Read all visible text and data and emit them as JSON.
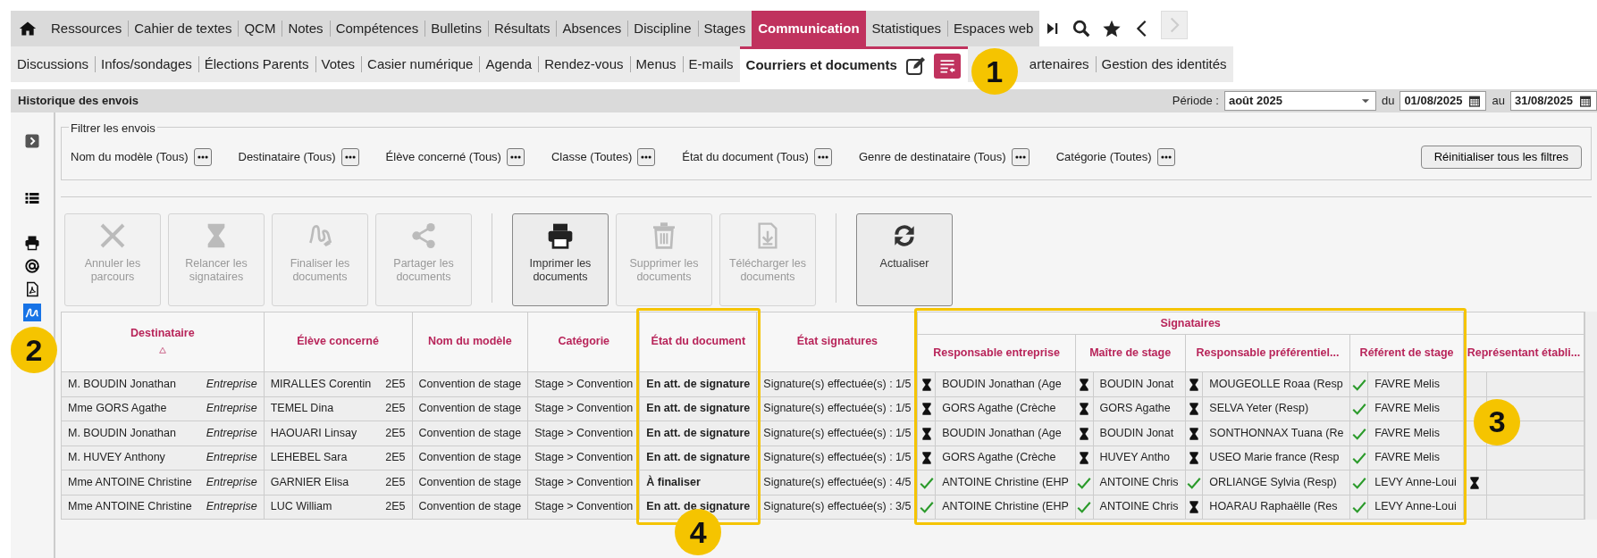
{
  "top_nav": {
    "items": [
      {
        "label": "Ressources",
        "selected": false
      },
      {
        "label": "Cahier de textes",
        "selected": false
      },
      {
        "label": "QCM",
        "selected": false
      },
      {
        "label": "Notes",
        "selected": false
      },
      {
        "label": "Compétences",
        "selected": false
      },
      {
        "label": "Bulletins",
        "selected": false
      },
      {
        "label": "Résultats",
        "selected": false
      },
      {
        "label": "Absences",
        "selected": false
      },
      {
        "label": "Discipline",
        "selected": false
      },
      {
        "label": "Stages",
        "selected": false
      },
      {
        "label": "Communication",
        "selected": true
      },
      {
        "label": "Statistiques",
        "selected": false
      },
      {
        "label": "Espaces web",
        "selected": false
      }
    ]
  },
  "sub_nav": {
    "items": [
      {
        "label": "Discussions",
        "selected": false
      },
      {
        "label": "Infos/sondages",
        "selected": false
      },
      {
        "label": "Élections Parents",
        "selected": false
      },
      {
        "label": "Votes",
        "selected": false
      },
      {
        "label": "Casier numérique",
        "selected": false
      },
      {
        "label": "Agenda",
        "selected": false
      },
      {
        "label": "Rendez-vous",
        "selected": false
      },
      {
        "label": "Menus",
        "selected": false
      },
      {
        "label": "E-mails",
        "selected": false
      },
      {
        "label": "Courriers et documents",
        "selected": true
      },
      {
        "label": "artenaires",
        "selected": false
      },
      {
        "label": "Gestion des identités",
        "selected": false
      }
    ]
  },
  "panel": {
    "title": "Historique des envois",
    "period_label": "Période :",
    "period": "août 2025",
    "from_label": "du",
    "from": "01/08/2025",
    "to_label": "au",
    "to": "31/08/2025"
  },
  "sidebar": {
    "items": [
      {
        "kind": "list",
        "selected": false
      },
      {
        "kind": "print",
        "selected": false
      },
      {
        "kind": "email",
        "selected": false
      },
      {
        "kind": "pdf",
        "selected": false
      },
      {
        "kind": "signature",
        "selected": true
      }
    ]
  },
  "filters": {
    "legend": "Filtrer les envois",
    "items": [
      "Nom du modèle (Tous)",
      "Destinataire (Tous)",
      "Élève concerné (Tous)",
      "Classe (Toutes)",
      "État du document (Tous)",
      "Genre de destinataire (Tous)",
      "Catégorie (Toutes)"
    ],
    "reset": "Réinitialiser tous les filtres"
  },
  "toolbar": [
    {
      "kind": "cancel",
      "label": "Annuler les parcours",
      "disabled": true
    },
    {
      "kind": "remind",
      "label": "Relancer les signataires",
      "disabled": true
    },
    {
      "kind": "finalize",
      "label": "Finaliser les documents",
      "disabled": true
    },
    {
      "kind": "share",
      "label": "Partager les documents",
      "disabled": true
    },
    {
      "kind": "print",
      "label": "Imprimer les documents",
      "disabled": false
    },
    {
      "kind": "delete",
      "label": "Supprimer les documents",
      "disabled": true
    },
    {
      "kind": "download",
      "label": "Télécharger les documents",
      "disabled": true
    },
    {
      "kind": "refresh",
      "label": "Actualiser",
      "disabled": false
    }
  ],
  "table": {
    "columns": [
      "Destinataire",
      "Élève concerné",
      "Nom du modèle",
      "Catégorie",
      "État du document",
      "État signatures"
    ],
    "group": "Signataires",
    "signatory_columns": [
      "Responsable entreprise",
      "Maître de stage",
      "Responsable préférentiel...",
      "Référent de stage",
      "Représentant établi..."
    ],
    "rows": [
      {
        "recipient": "M. BOUDIN Jonathan",
        "recipient_type": "Entreprise",
        "student": "MIRALLES Corentin",
        "class": "2E5",
        "model": "Convention de stage",
        "category": "Stage > Convention",
        "doc_state": "En att. de signature",
        "sig_state": "Signature(s) effectuée(s) : 1/5",
        "signatories": [
          {
            "signed": false,
            "name": "BOUDIN Jonathan (Age"
          },
          {
            "signed": false,
            "name": "BOUDIN Jonat"
          },
          {
            "signed": false,
            "name": "MOUGEOLLE Roaa (Resp"
          },
          {
            "signed": true,
            "name": "FAVRE Melis"
          }
        ]
      },
      {
        "recipient": "Mme GORS Agathe",
        "recipient_type": "Entreprise",
        "student": "TEMEL Dina",
        "class": "2E5",
        "model": "Convention de stage",
        "category": "Stage > Convention",
        "doc_state": "En att. de signature",
        "sig_state": "Signature(s) effectuée(s) : 1/5",
        "signatories": [
          {
            "signed": false,
            "name": "GORS Agathe (Crèche"
          },
          {
            "signed": false,
            "name": "GORS Agathe"
          },
          {
            "signed": false,
            "name": "SELVA Yeter (Resp)"
          },
          {
            "signed": true,
            "name": "FAVRE Melis"
          }
        ]
      },
      {
        "recipient": "M. BOUDIN Jonathan",
        "recipient_type": "Entreprise",
        "student": "HAOUARI Linsay",
        "class": "2E5",
        "model": "Convention de stage",
        "category": "Stage > Convention",
        "doc_state": "En att. de signature",
        "sig_state": "Signature(s) effectuée(s) : 1/5",
        "signatories": [
          {
            "signed": false,
            "name": "BOUDIN Jonathan (Age"
          },
          {
            "signed": false,
            "name": "BOUDIN Jonat"
          },
          {
            "signed": false,
            "name": "SONTHONNAX Tuana (Re"
          },
          {
            "signed": true,
            "name": "FAVRE Melis"
          }
        ]
      },
      {
        "recipient": "M. HUVEY Anthony",
        "recipient_type": "Entreprise",
        "student": "LEHEBEL Sara",
        "class": "2E5",
        "model": "Convention de stage",
        "category": "Stage > Convention",
        "doc_state": "En att. de signature",
        "sig_state": "Signature(s) effectuée(s) : 1/5",
        "signatories": [
          {
            "signed": false,
            "name": "GORS Agathe (Crèche"
          },
          {
            "signed": false,
            "name": "HUVEY Antho"
          },
          {
            "signed": false,
            "name": "USEO Marie france (Resp"
          },
          {
            "signed": true,
            "name": "FAVRE Melis"
          }
        ]
      },
      {
        "recipient": "Mme ANTOINE Christine",
        "recipient_type": "Entreprise",
        "student": "GARNIER Elisa",
        "class": "2E5",
        "model": "Convention de stage",
        "category": "Stage > Convention",
        "doc_state": "À finaliser",
        "sig_state": "Signature(s) effectuée(s) : 4/5",
        "signatories": [
          {
            "signed": true,
            "name": "ANTOINE Christine (EHP"
          },
          {
            "signed": true,
            "name": "ANTOINE Chris"
          },
          {
            "signed": true,
            "name": "ORLIANGE Sylvia (Resp)"
          },
          {
            "signed": true,
            "name": "LEVY Anne-Loui"
          },
          {
            "signed": false
          }
        ]
      },
      {
        "recipient": "Mme ANTOINE Christine",
        "recipient_type": "Entreprise",
        "student": "LUC William",
        "class": "2E5",
        "model": "Convention de stage",
        "category": "Stage > Convention",
        "doc_state": "En att. de signature",
        "sig_state": "Signature(s) effectuée(s) : 3/5",
        "signatories": [
          {
            "signed": true,
            "name": "ANTOINE Christine (EHP"
          },
          {
            "signed": true,
            "name": "ANTOINE Chris"
          },
          {
            "signed": false,
            "name": "HOARAU Raphaëlle (Res"
          },
          {
            "signed": true,
            "name": "LEVY Anne-Loui"
          }
        ]
      }
    ]
  },
  "callouts": [
    "1",
    "2",
    "3",
    "4"
  ]
}
